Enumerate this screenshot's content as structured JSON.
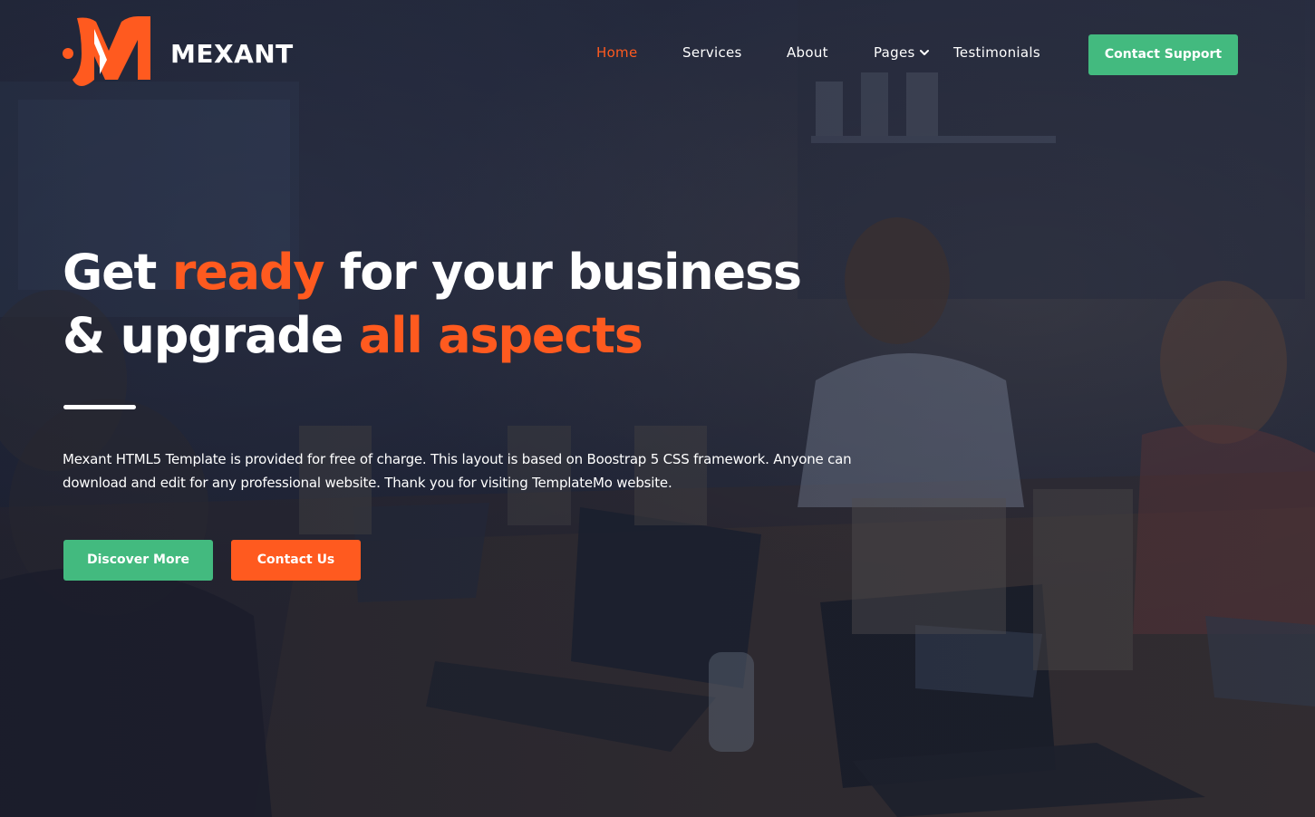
{
  "brand": {
    "name": "MEXANT",
    "colors": {
      "accent_orange": "#ff5a1f",
      "accent_green": "#43ba7f",
      "text_white": "#ffffff"
    }
  },
  "nav": {
    "items": [
      {
        "label": "Home",
        "active": true
      },
      {
        "label": "Services",
        "active": false
      },
      {
        "label": "About",
        "active": false
      },
      {
        "label": "Pages",
        "active": false,
        "icon": "chevron-down-icon"
      },
      {
        "label": "Testimonials",
        "active": false
      }
    ],
    "cta_label": "Contact Support"
  },
  "hero": {
    "title_line1": {
      "part1": "Get ",
      "accent1": "ready",
      "part2": " for your business"
    },
    "title_line2": {
      "part1": "& upgrade ",
      "accent1": "all aspects"
    },
    "description": "Mexant HTML5 Template is provided for free of charge. This layout is based on Boostrap 5 CSS framework. Anyone can download and edit for any professional website. Thank you for visiting TemplateMo website.",
    "primary_button": "Discover More",
    "secondary_button": "Contact Us"
  }
}
